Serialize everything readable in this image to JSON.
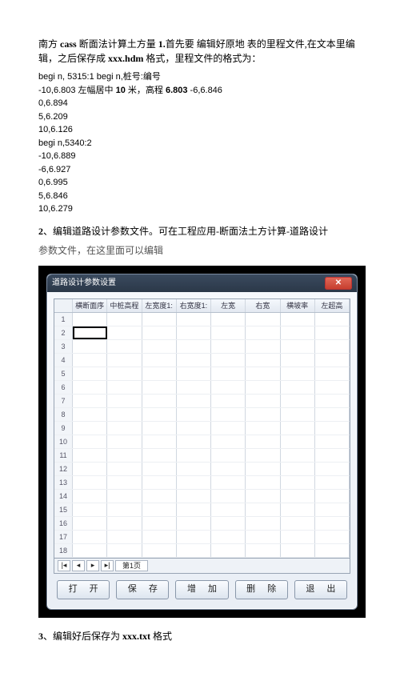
{
  "intro": {
    "p1_a": "南方 ",
    "p1_b": "cass",
    "p1_c": " 断面法计算土方量  ",
    "p1_d": "1.",
    "p1_e": "首先要  编辑好原地  表的里程文件,在文本里编辑，之后保存成  ",
    "p1_f": "xxx.hdm",
    "p1_g": " 格式，里程文件的格式为："
  },
  "lines": [
    "begi n, 5315:1 begi n,桩号:编号",
    "-10,6.803 左幅居中 10 米，高程 6.803 -6,6.846",
    "0,6.894",
    "5,6.209",
    "10,6.126",
    "begi n,5340:2",
    "-10,6.889",
    "-6,6.927",
    "0,6.995",
    "5,6.846",
    "10,6.279"
  ],
  "bold_tokens": {
    "l1_a": "10",
    "l1_b": "6.803"
  },
  "step2": {
    "lead": "2",
    "text": "、编辑道路设计参数文件。可在工程应用-断面法土方计算-道路设计"
  },
  "sub": "参数文件，在这里面可以编辑",
  "dialog": {
    "title": "道路设计参数设置",
    "columns": [
      "横断面序号",
      "中桩高程",
      "左宽度1:",
      "右宽度1:",
      "左宽",
      "右宽",
      "横坡率",
      "左超高"
    ],
    "row_count": 18,
    "tab": "第1页",
    "buttons": [
      "打 开",
      "保 存",
      "增 加",
      "删 除",
      "退 出"
    ]
  },
  "step3": {
    "lead": "3",
    "a": "、编辑好后保存为 ",
    "b": "xxx.txt",
    "c": " 格式"
  }
}
